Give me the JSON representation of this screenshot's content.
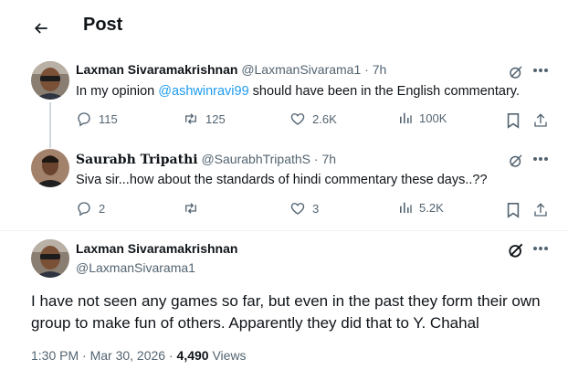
{
  "header": {
    "title": "Post",
    "back_icon": "arrow-left-icon"
  },
  "replies": [
    {
      "name": "Laxman Sivaramakrishnan",
      "handle": "@LaxmanSivarama1",
      "time": "7h",
      "text_before": "In my opinion ",
      "mention": "@ashwinravi99",
      "text_after": " should have been in the English commentary.",
      "stats": {
        "replies": "115",
        "reposts": "125",
        "likes": "2.6K",
        "views": "100K"
      }
    },
    {
      "name": "Saurabh Tripathi",
      "handle": "@SaurabhTripathS",
      "time": "7h",
      "text": "Siva sir...how about the standards of hindi commentary these days..??",
      "stats": {
        "replies": "2",
        "reposts": "",
        "likes": "3",
        "views": "5.2K"
      }
    }
  ],
  "main_post": {
    "name": "Laxman Sivaramakrishnan",
    "handle": "@LaxmanSivarama1",
    "text": "I have not seen any games so far, but even in the past they form their own group to make fun of others. Apparently they did that to Y. Chahal",
    "timestamp": "1:30 PM · Mar 30, 2026 · ",
    "views_count": "4,490",
    "views_label": " Views"
  },
  "separator": "·",
  "accent_color": "#1d9bf0"
}
